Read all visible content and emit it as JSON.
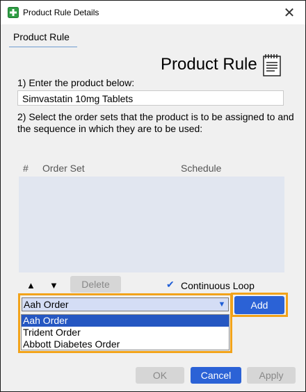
{
  "window": {
    "title": "Product Rule Details",
    "tab_label": "Product Rule",
    "heading": "Product Rule"
  },
  "step1": {
    "label": "1) Enter the product below:",
    "product_value": "Simvastatin 10mg Tablets"
  },
  "step2": {
    "label": "2) Select the order sets that the product is to be assigned to and the sequence in which they are to be used:"
  },
  "grid": {
    "columns": [
      "#",
      "Order Set",
      "Schedule"
    ],
    "rows": []
  },
  "controls": {
    "delete_label": "Delete",
    "continuous_loop_label": "Continuous Loop",
    "continuous_loop_checked": true,
    "add_label": "Add"
  },
  "order_set_select": {
    "selected": "Aah Order",
    "options": [
      "Aah Order",
      "Trident Order",
      "Abbott Diabetes Order"
    ]
  },
  "footer": {
    "ok_label": "OK",
    "cancel_label": "Cancel",
    "apply_label": "Apply"
  },
  "colors": {
    "accent": "#2b62d6",
    "highlight_border": "#f2a31a",
    "grid_background": "#e1e6f0",
    "dropdown_selected": "#2557c2"
  }
}
